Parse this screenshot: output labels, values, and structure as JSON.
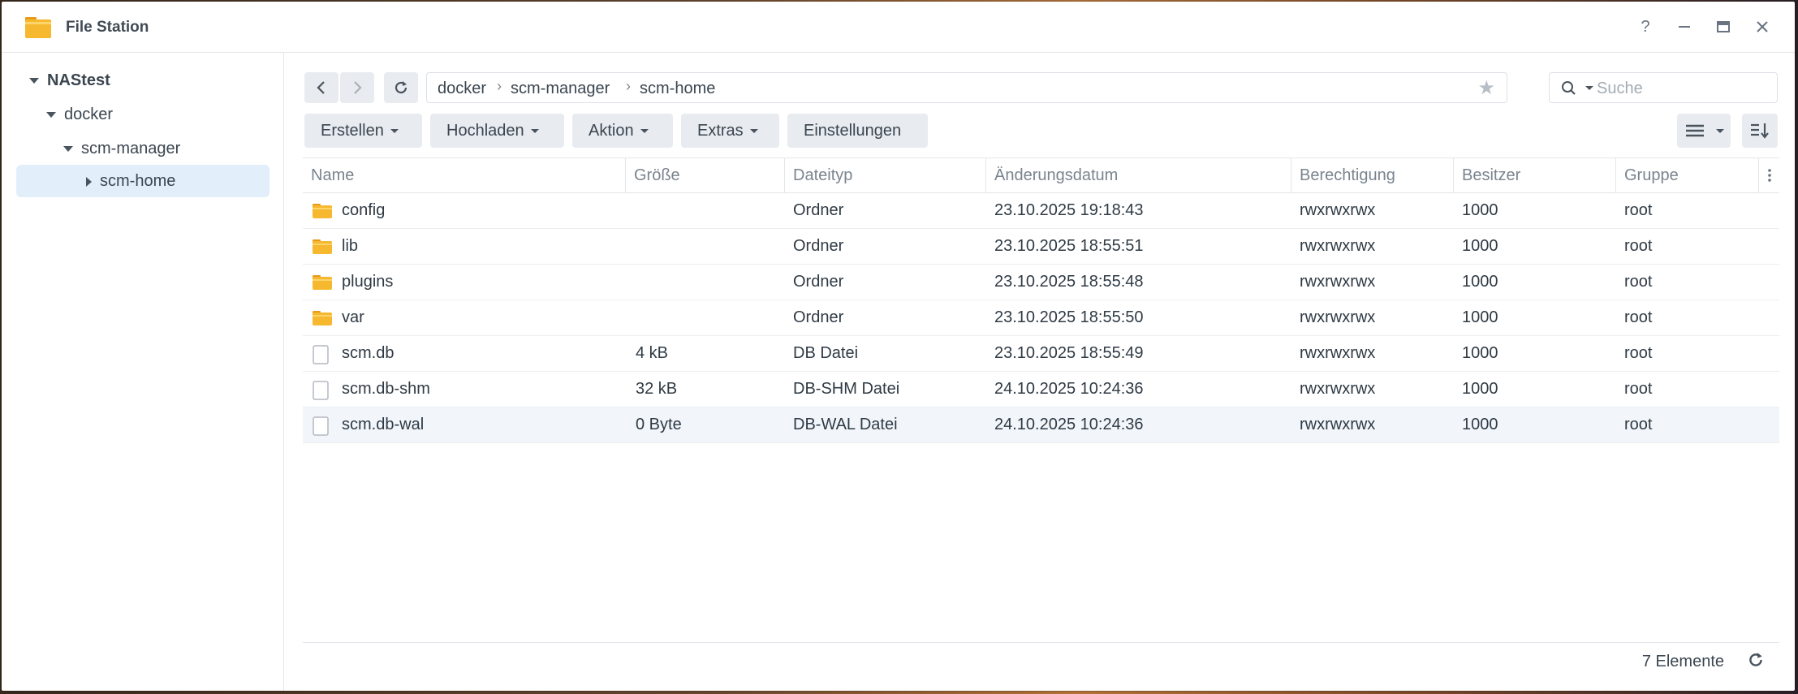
{
  "window": {
    "title": "File Station",
    "controls": [
      "help-icon",
      "minimize-icon",
      "maximize-icon",
      "close-icon"
    ],
    "help_label": "?"
  },
  "sidebar": {
    "items": [
      {
        "label": "NAStest",
        "expanded": true,
        "selected": false
      },
      {
        "label": "docker",
        "expanded": true,
        "selected": false
      },
      {
        "label": "scm-manager",
        "expanded": true,
        "selected": false
      },
      {
        "label": "scm-home",
        "expanded": false,
        "selected": true
      }
    ]
  },
  "toolbar": {
    "path": [
      "docker",
      "scm-manager",
      "scm-home"
    ],
    "search_placeholder": "Suche",
    "buttons": {
      "create": "Erstellen",
      "upload": "Hochladen",
      "action": "Aktion",
      "extras": "Extras",
      "settings": "Einstellungen"
    }
  },
  "table": {
    "columns": [
      "Name",
      "Größe",
      "Dateityp",
      "Änderungsdatum",
      "Berechtigung",
      "Besitzer",
      "Gruppe"
    ],
    "rows": [
      {
        "name": "config",
        "size": "",
        "type": "Ordner",
        "modified": "23.10.2025 19:18:43",
        "perm": "rwxrwxrwx",
        "owner": "1000",
        "group": "root",
        "icon": "folder-icon"
      },
      {
        "name": "lib",
        "size": "",
        "type": "Ordner",
        "modified": "23.10.2025 18:55:51",
        "perm": "rwxrwxrwx",
        "owner": "1000",
        "group": "root",
        "icon": "folder-icon"
      },
      {
        "name": "plugins",
        "size": "",
        "type": "Ordner",
        "modified": "23.10.2025 18:55:48",
        "perm": "rwxrwxrwx",
        "owner": "1000",
        "group": "root",
        "icon": "folder-icon"
      },
      {
        "name": "var",
        "size": "",
        "type": "Ordner",
        "modified": "23.10.2025 18:55:50",
        "perm": "rwxrwxrwx",
        "owner": "1000",
        "group": "root",
        "icon": "folder-icon"
      },
      {
        "name": "scm.db",
        "size": "4 kB",
        "type": "DB Datei",
        "modified": "23.10.2025 18:55:49",
        "perm": "rwxrwxrwx",
        "owner": "1000",
        "group": "root",
        "icon": "file-icon"
      },
      {
        "name": "scm.db-shm",
        "size": "32 kB",
        "type": "DB-SHM Datei",
        "modified": "24.10.2025 10:24:36",
        "perm": "rwxrwxrwx",
        "owner": "1000",
        "group": "root",
        "icon": "file-icon"
      },
      {
        "name": "scm.db-wal",
        "size": "0 Byte",
        "type": "DB-WAL Datei",
        "modified": "24.10.2025 10:24:36",
        "perm": "rwxrwxrwx",
        "owner": "1000",
        "group": "root",
        "icon": "file-icon",
        "selected": true
      }
    ]
  },
  "footer": {
    "count": "7 Elemente"
  },
  "colors": {
    "folder": "#f5b82e",
    "selection": "#e3eefb",
    "button_bg": "#e8ebef"
  }
}
